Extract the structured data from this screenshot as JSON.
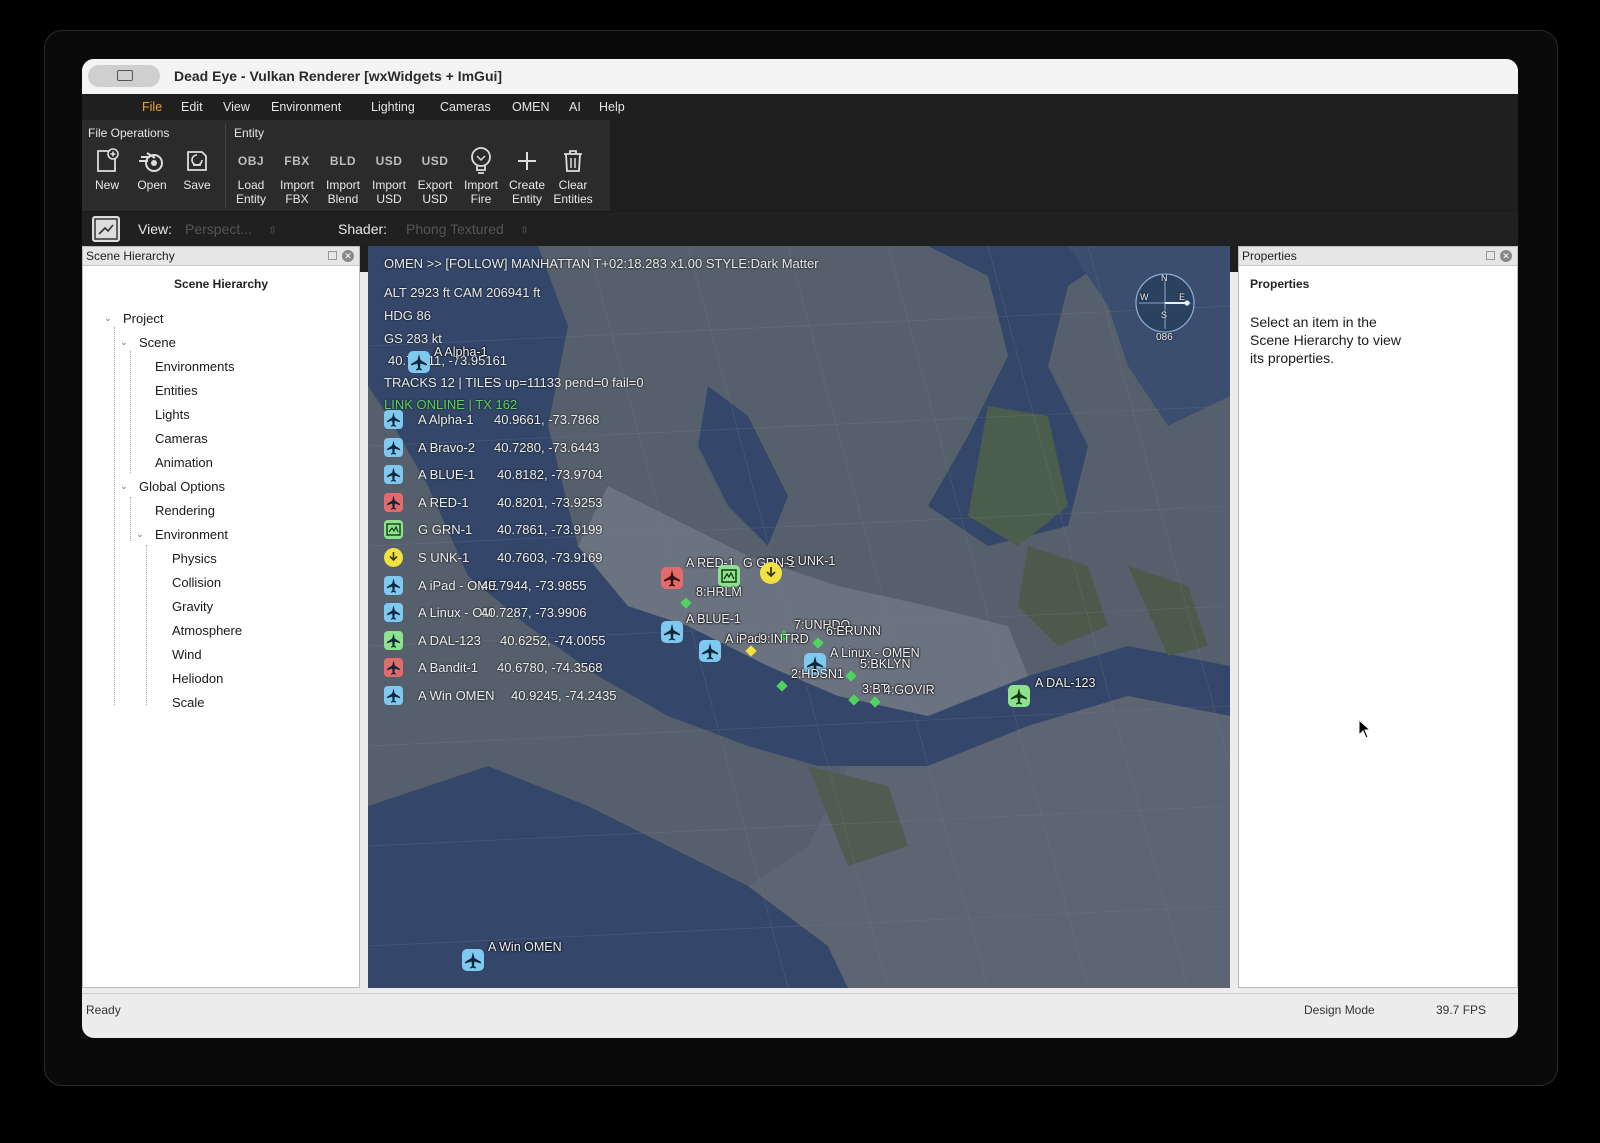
{
  "window": {
    "title": "Dead Eye - Vulkan Renderer [wxWidgets + ImGui]"
  },
  "menu": [
    "File",
    "Edit",
    "View",
    "Environment",
    "Lighting",
    "Cameras",
    "OMEN",
    "AI",
    "Help"
  ],
  "ribbon": {
    "file_group": "File Operations",
    "entity_group": "Entity",
    "file_tools": [
      {
        "label": "New",
        "icon": "new-file-icon"
      },
      {
        "label": "Open",
        "icon": "blender-open-icon"
      },
      {
        "label": "Save",
        "icon": "save-icon"
      }
    ],
    "entity_tools": [
      {
        "label1": "Load",
        "label2": "Entity",
        "badge": "OBJ"
      },
      {
        "label1": "Import",
        "label2": "FBX",
        "badge": "FBX"
      },
      {
        "label1": "Import",
        "label2": "Blend",
        "badge": "BLD"
      },
      {
        "label1": "Import",
        "label2": "USD",
        "badge": "USD"
      },
      {
        "label1": "Export",
        "label2": "USD",
        "badge": "USD"
      },
      {
        "label1": "Import",
        "label2": "Fire",
        "icon": "fire-bulb-icon"
      },
      {
        "label1": "Create",
        "label2": "Entity",
        "icon": "plus-icon"
      },
      {
        "label1": "Clear",
        "label2": "Entities",
        "icon": "trash-icon"
      }
    ]
  },
  "toolbar": {
    "view_label": "View:",
    "view_value": "Perspect...",
    "shader_label": "Shader:",
    "shader_value": "Phong Textured"
  },
  "scene_hierarchy": {
    "panel_title": "Scene Hierarchy",
    "heading": "Scene Hierarchy",
    "tree": [
      {
        "label": "Project",
        "level": 0
      },
      {
        "label": "Scene",
        "level": 1
      },
      {
        "label": "Environments",
        "level": 2
      },
      {
        "label": "Entities",
        "level": 2
      },
      {
        "label": "Lights",
        "level": 2
      },
      {
        "label": "Cameras",
        "level": 2
      },
      {
        "label": "Animation",
        "level": 2
      },
      {
        "label": "Global Options",
        "level": 1
      },
      {
        "label": "Rendering",
        "level": 2
      },
      {
        "label": "Environment",
        "level": 2
      },
      {
        "label": "Physics",
        "level": 3
      },
      {
        "label": "Collision",
        "level": 3
      },
      {
        "label": "Gravity",
        "level": 3
      },
      {
        "label": "Atmosphere",
        "level": 3
      },
      {
        "label": "Wind",
        "level": 3
      },
      {
        "label": "Heliodon",
        "level": 3
      },
      {
        "label": "Scale",
        "level": 3
      }
    ]
  },
  "properties": {
    "panel_title": "Properties",
    "heading": "Properties",
    "message_line1": "Select an item in the",
    "message_line2": "Scene Hierarchy to view",
    "message_line3": "its properties."
  },
  "viewport": {
    "header": "OMEN >> [FOLLOW] MANHATTAN T+02:18.283 x1.00 STYLE:Dark Matter",
    "alt": "ALT   2923 ft  CAM 206941 ft",
    "hdg": "HDG  86",
    "gs": "GS   283 kt",
    "pos": "40.74511, -73.95161",
    "tracks": "TRACKS 12 | TILES up=11133 pend=0 fail=0",
    "link": "LINK ONLINE | TX 162",
    "compass": {
      "n": "N",
      "e": "E",
      "s": "S",
      "w": "W",
      "heading": "086"
    },
    "track_list": [
      {
        "name": "A Alpha-1",
        "coord": "40.9661, -73.7868",
        "color": "#7fc8ef",
        "icon": "aircraft-icon"
      },
      {
        "name": "A Bravo-2",
        "coord": "40.7280, -73.6443",
        "color": "#7fc8ef",
        "icon": "aircraft-icon"
      },
      {
        "name": "A BLUE-1",
        "coord": "40.8182, -73.9704",
        "color": "#7fc8ef",
        "icon": "aircraft-icon"
      },
      {
        "name": "A RED-1",
        "coord": "40.8201, -73.9253",
        "color": "#e46b6b",
        "icon": "aircraft-icon"
      },
      {
        "name": "G GRN-1",
        "coord": "40.7861, -73.9199",
        "color": "#8ee28e",
        "icon": "ground-unit-icon"
      },
      {
        "name": "S UNK-1",
        "coord": "40.7603, -73.9169",
        "color": "#f2e142",
        "icon": "unknown-surface-icon"
      },
      {
        "name": "A iPad - OME",
        "coord": "40.7944, -73.9855",
        "color": "#7fc8ef",
        "icon": "aircraft-icon"
      },
      {
        "name": "A Linux - OM",
        "coord": "40.7287, -73.9906",
        "color": "#7fc8ef",
        "icon": "aircraft-icon"
      },
      {
        "name": "A DAL-123",
        "coord": "40.6252, -74.0055",
        "color": "#8ee28e",
        "icon": "aircraft-icon"
      },
      {
        "name": "A Bandit-1",
        "coord": "40.6780, -74.3568",
        "color": "#e46b6b",
        "icon": "aircraft-icon"
      },
      {
        "name": "A Win OMEN",
        "coord": "40.9245, -74.2435",
        "color": "#7fc8ef",
        "icon": "aircraft-icon"
      }
    ],
    "map_labels": {
      "alpha": "A Alpha-1",
      "red1": "A RED-1",
      "grn": "G GRN-1",
      "unk": "S UNK-1",
      "hrlm": "8:HRLM",
      "blue1": "A BLUE-1",
      "unhdq": "7:UNHDQ",
      "erunn": "6:ERUNN",
      "ipad": "A iPad",
      "intrd": "9:INTRD",
      "linux": "A Linux - OMEN",
      "bklyn": "5:BKLYN",
      "hdsn": "2:HDSN1",
      "bt": "3:BT",
      "govir": "4:GOVIR",
      "dal": "A DAL-123",
      "win": "A Win OMEN"
    }
  },
  "status_bar": {
    "left": "Ready",
    "mode": "Design Mode",
    "fps": "39.7 FPS"
  }
}
